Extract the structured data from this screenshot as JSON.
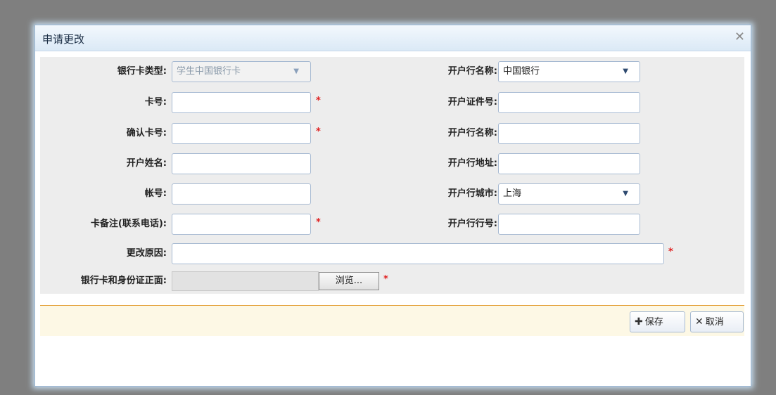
{
  "dialog": {
    "title": "申请更改",
    "close_icon": "close-icon"
  },
  "form": {
    "bank_card_type": {
      "label": "银行卡类型:",
      "value": "学生中国银行卡"
    },
    "card_number": {
      "label": "卡号:",
      "value": ""
    },
    "confirm_card_number": {
      "label": "确认卡号:",
      "value": ""
    },
    "account_holder": {
      "label": "开户姓名:",
      "value": ""
    },
    "account_number": {
      "label": "帐号:",
      "value": ""
    },
    "card_remark": {
      "label": "卡备注(联系电话):",
      "value": ""
    },
    "change_reason": {
      "label": "更改原因:",
      "value": ""
    },
    "id_upload": {
      "label": "银行卡和身份证正面:",
      "browse_label": "浏览..."
    },
    "bank_name_select": {
      "label": "开户行名称:",
      "value": "中国银行"
    },
    "id_number": {
      "label": "开户证件号:",
      "value": ""
    },
    "bank_name_text": {
      "label": "开户行名称:",
      "value": ""
    },
    "bank_address": {
      "label": "开户行地址:",
      "value": ""
    },
    "bank_city": {
      "label": "开户行城市:",
      "value": "上海"
    },
    "bank_branch_number": {
      "label": "开户行行号:",
      "value": ""
    },
    "required_mark": "*"
  },
  "footer": {
    "save_label": "保存",
    "cancel_label": "取消",
    "save_icon": "plus-icon",
    "cancel_icon": "x-icon"
  },
  "colors": {
    "title_bar": "#dbe9f6",
    "form_background": "#ededed",
    "footer_background": "#fdf8e5",
    "footer_separator": "#e19a2b",
    "required": "#e02020"
  }
}
